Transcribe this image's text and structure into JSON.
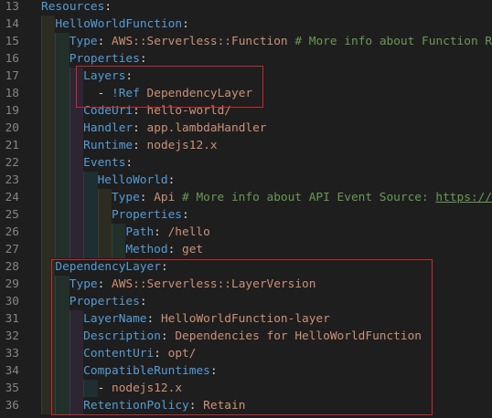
{
  "editor": {
    "colors": {
      "key": "#569cd6",
      "string": "#ce9178",
      "comment": "#6a9955",
      "punct": "#d4d4d4",
      "highlight_box": "#c8282e"
    },
    "lines": [
      {
        "num": "13",
        "indent": 0,
        "tokens": [
          {
            "t": "Resources",
            "c": "k"
          },
          {
            "t": ":",
            "c": "p"
          }
        ]
      },
      {
        "num": "14",
        "indent": 1,
        "tokens": [
          {
            "t": "HelloWorldFunction",
            "c": "k"
          },
          {
            "t": ":",
            "c": "p"
          }
        ]
      },
      {
        "num": "15",
        "indent": 2,
        "tokens": [
          {
            "t": "Type",
            "c": "k"
          },
          {
            "t": ": ",
            "c": "p"
          },
          {
            "t": "AWS::Serverless::Function",
            "c": "s"
          },
          {
            "t": " # More info about Function R",
            "c": "c"
          }
        ]
      },
      {
        "num": "16",
        "indent": 2,
        "tokens": [
          {
            "t": "Properties",
            "c": "k"
          },
          {
            "t": ":",
            "c": "p"
          }
        ]
      },
      {
        "num": "17",
        "indent": 3,
        "tokens": [
          {
            "t": "Layers",
            "c": "k"
          },
          {
            "t": ":",
            "c": "p"
          }
        ]
      },
      {
        "num": "18",
        "indent": 3,
        "tokens": [
          {
            "t": "  - ",
            "c": "p"
          },
          {
            "t": "!Ref",
            "c": "k"
          },
          {
            "t": " ",
            "c": "p"
          },
          {
            "t": "DependencyLayer",
            "c": "s"
          }
        ]
      },
      {
        "num": "19",
        "indent": 3,
        "tokens": [
          {
            "t": "CodeUri",
            "c": "k"
          },
          {
            "t": ": ",
            "c": "p"
          },
          {
            "t": "hello-world/",
            "c": "s"
          }
        ]
      },
      {
        "num": "20",
        "indent": 3,
        "tokens": [
          {
            "t": "Handler",
            "c": "k"
          },
          {
            "t": ": ",
            "c": "p"
          },
          {
            "t": "app.lambdaHandler",
            "c": "s"
          }
        ]
      },
      {
        "num": "21",
        "indent": 3,
        "tokens": [
          {
            "t": "Runtime",
            "c": "k"
          },
          {
            "t": ": ",
            "c": "p"
          },
          {
            "t": "nodejs12.x",
            "c": "s"
          }
        ]
      },
      {
        "num": "22",
        "indent": 3,
        "tokens": [
          {
            "t": "Events",
            "c": "k"
          },
          {
            "t": ":",
            "c": "p"
          }
        ]
      },
      {
        "num": "23",
        "indent": 4,
        "tokens": [
          {
            "t": "HelloWorld",
            "c": "k"
          },
          {
            "t": ":",
            "c": "p"
          }
        ]
      },
      {
        "num": "24",
        "indent": 5,
        "tokens": [
          {
            "t": "Type",
            "c": "k"
          },
          {
            "t": ": ",
            "c": "p"
          },
          {
            "t": "Api",
            "c": "s"
          },
          {
            "t": " # More info about API Event Source: ",
            "c": "c"
          },
          {
            "t": "https://",
            "c": "u"
          }
        ]
      },
      {
        "num": "25",
        "indent": 5,
        "tokens": [
          {
            "t": "Properties",
            "c": "k"
          },
          {
            "t": ":",
            "c": "p"
          }
        ]
      },
      {
        "num": "26",
        "indent": 6,
        "tokens": [
          {
            "t": "Path",
            "c": "k"
          },
          {
            "t": ": ",
            "c": "p"
          },
          {
            "t": "/hello",
            "c": "s"
          }
        ]
      },
      {
        "num": "27",
        "indent": 6,
        "tokens": [
          {
            "t": "Method",
            "c": "k"
          },
          {
            "t": ": ",
            "c": "p"
          },
          {
            "t": "get",
            "c": "s"
          }
        ]
      },
      {
        "num": "28",
        "indent": 1,
        "tokens": [
          {
            "t": "DependencyLayer",
            "c": "k"
          },
          {
            "t": ":",
            "c": "p"
          }
        ]
      },
      {
        "num": "29",
        "indent": 2,
        "tokens": [
          {
            "t": "Type",
            "c": "k"
          },
          {
            "t": ": ",
            "c": "p"
          },
          {
            "t": "AWS::Serverless::LayerVersion",
            "c": "s"
          }
        ]
      },
      {
        "num": "30",
        "indent": 2,
        "tokens": [
          {
            "t": "Properties",
            "c": "k"
          },
          {
            "t": ":",
            "c": "p"
          }
        ]
      },
      {
        "num": "31",
        "indent": 3,
        "tokens": [
          {
            "t": "LayerName",
            "c": "k"
          },
          {
            "t": ": ",
            "c": "p"
          },
          {
            "t": "HelloWorldFunction-layer",
            "c": "s"
          }
        ]
      },
      {
        "num": "32",
        "indent": 3,
        "tokens": [
          {
            "t": "Description",
            "c": "k"
          },
          {
            "t": ": ",
            "c": "p"
          },
          {
            "t": "Dependencies for HelloWorldFunction",
            "c": "s"
          }
        ]
      },
      {
        "num": "33",
        "indent": 3,
        "tokens": [
          {
            "t": "ContentUri",
            "c": "k"
          },
          {
            "t": ": ",
            "c": "p"
          },
          {
            "t": "opt/",
            "c": "s"
          }
        ]
      },
      {
        "num": "34",
        "indent": 3,
        "tokens": [
          {
            "t": "CompatibleRuntimes",
            "c": "k"
          },
          {
            "t": ":",
            "c": "p"
          }
        ]
      },
      {
        "num": "35",
        "indent": 4,
        "tokens": [
          {
            "t": "- ",
            "c": "p"
          },
          {
            "t": "nodejs12.x",
            "c": "s"
          }
        ]
      },
      {
        "num": "36",
        "indent": 3,
        "tokens": [
          {
            "t": "RetentionPolicy",
            "c": "k"
          },
          {
            "t": ": ",
            "c": "p"
          },
          {
            "t": "Retain",
            "c": "s"
          }
        ]
      }
    ]
  }
}
